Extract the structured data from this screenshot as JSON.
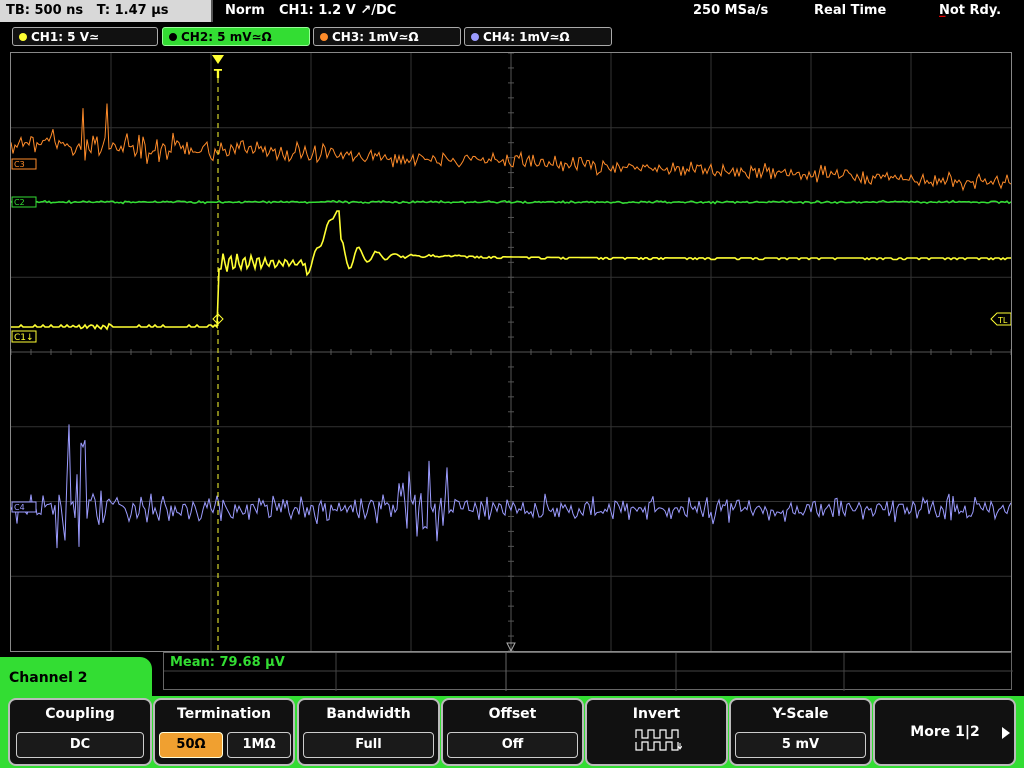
{
  "status": {
    "timebase": "TB: 500 ns",
    "trigger_time": "T: 1.47 µs",
    "mode": "Norm",
    "trigger_info": "CH1: 1.2 V ↗/DC",
    "sample_rate": "250 MSa/s",
    "acq_mode": "Real Time",
    "state": "Not Rdy."
  },
  "channels": [
    {
      "label": "CH1: 5 V≃",
      "color": "#ffff33"
    },
    {
      "label": "CH2: 5 mV≃Ω",
      "color": "#33dd33"
    },
    {
      "label": "CH3: 1mV≃Ω",
      "color": "#ff8c2a"
    },
    {
      "label": "CH4: 1mV≃Ω",
      "color": "#9c9cff"
    }
  ],
  "markers": {
    "trigger": "T",
    "trigger_level": "TL",
    "ch1_ref": "C1",
    "ch1_ref_low": "C1↓",
    "ch2_ref": "C2",
    "ch3_ref": "C3",
    "ch4_ref": "C4"
  },
  "measurement": {
    "mean": "Mean: 79.68 µV"
  },
  "menu": {
    "channel_title": "Channel 2",
    "coupling": {
      "title": "Coupling",
      "value": "DC"
    },
    "termination": {
      "title": "Termination",
      "opt1": "50Ω",
      "opt2": "1MΩ"
    },
    "bandwidth": {
      "title": "Bandwidth",
      "value": "Full"
    },
    "offset": {
      "title": "Offset",
      "value": "Off"
    },
    "invert": {
      "title": "Invert"
    },
    "yscale": {
      "title": "Y-Scale",
      "value": "5 mV"
    },
    "more": {
      "label": "More 1|2"
    }
  }
}
